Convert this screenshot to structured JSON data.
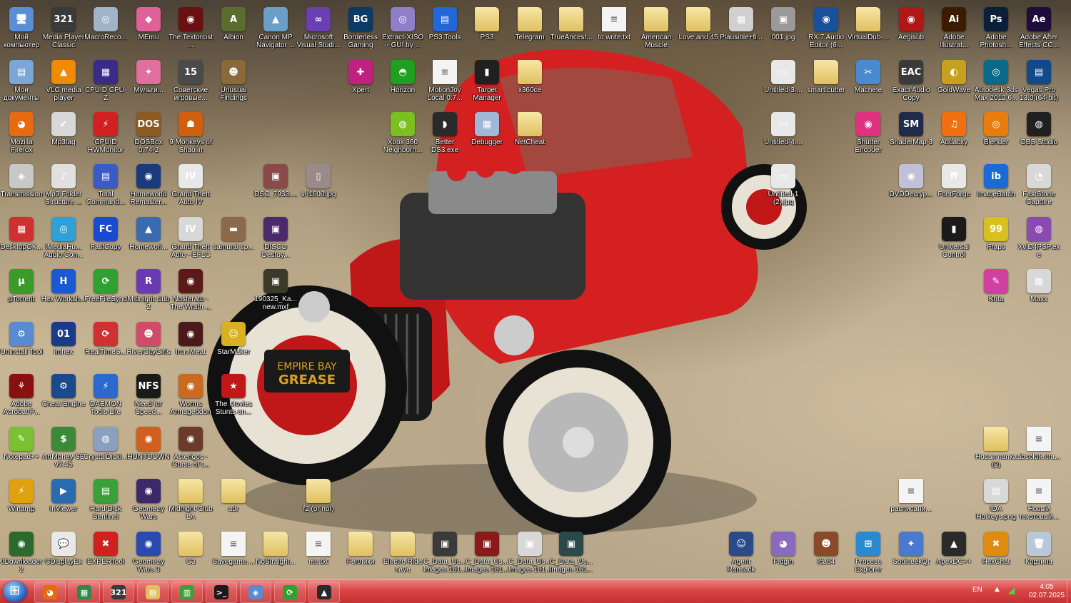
{
  "desktop": {
    "icons": [
      {
        "label": "Мой компьютер",
        "icon": "computer-icon",
        "glyph": "🖥",
        "color": "#5a8fd6"
      },
      {
        "label": "Media Player Classic",
        "icon": "mpc-icon",
        "glyph": "321",
        "color": "#3a3a3a"
      },
      {
        "label": "MacroReco...",
        "icon": "macro-icon",
        "glyph": "◎",
        "color": "#9fb4c8"
      },
      {
        "label": "MEmu",
        "icon": "memu-icon",
        "glyph": "◆",
        "color": "#e0609a"
      },
      {
        "label": "The Textorcist ...",
        "icon": "textorcist-icon",
        "glyph": "◉",
        "color": "#6a1010"
      },
      {
        "label": "Albion",
        "icon": "albion-icon",
        "glyph": "A",
        "color": "#5b6d2e"
      },
      {
        "label": "Canon MP Navigator ...",
        "icon": "canon-icon",
        "glyph": "▲",
        "color": "#6a9fc8"
      },
      {
        "label": "Microsoft Visual Studi...",
        "icon": "visual-studio-icon",
        "glyph": "∞",
        "color": "#6a3fb0"
      },
      {
        "label": "Borderless Gaming",
        "icon": "borderless-gaming-icon",
        "glyph": "BG",
        "color": "#0c3a66"
      },
      {
        "label": "Extract-XISO -- GUI by ...",
        "icon": "xiso-icon",
        "glyph": "◎",
        "color": "#8f7fc8"
      },
      {
        "label": "PS3 Tools",
        "icon": "ps3-tools-icon",
        "glyph": "▤",
        "color": "#2266d8"
      },
      {
        "label": "PS3",
        "icon": "folder-icon",
        "glyph": "",
        "color": ""
      },
      {
        "label": "Telegram",
        "icon": "folder-icon",
        "glyph": "",
        "color": ""
      },
      {
        "label": "TrueAncest...",
        "icon": "folder-icon",
        "glyph": "",
        "color": ""
      },
      {
        "label": "to write.txt",
        "icon": "text-file-icon",
        "glyph": "",
        "color": ""
      },
      {
        "label": "American Muscle",
        "icon": "folder-icon",
        "glyph": "",
        "color": ""
      },
      {
        "label": "Love and 45",
        "icon": "folder-icon",
        "glyph": "",
        "color": ""
      },
      {
        "label": "Plausible+fi...",
        "icon": "image-file-icon",
        "glyph": "▦",
        "color": "#d0d0d0"
      },
      {
        "label": "001.jpg",
        "icon": "image-file-icon",
        "glyph": "▣",
        "color": "#9a9a9a"
      },
      {
        "label": "RX 7 Audio Editor (6...",
        "icon": "rx7-icon",
        "glyph": "◉",
        "color": "#1a4f9c"
      },
      {
        "label": "VirtualDub-...",
        "icon": "folder-icon",
        "glyph": "",
        "color": ""
      },
      {
        "label": "Aegisub",
        "icon": "aegisub-icon",
        "glyph": "◉",
        "color": "#b01818"
      },
      {
        "label": "Adobe Illustrat...",
        "icon": "illustrator-icon",
        "glyph": "Ai",
        "color": "#3b1c00"
      },
      {
        "label": "Adobe Photosh...",
        "icon": "photoshop-icon",
        "glyph": "Ps",
        "color": "#0b1f3a"
      },
      {
        "label": "Adobe After Effects CC...",
        "icon": "after-effects-icon",
        "glyph": "Ae",
        "color": "#1c0d3a"
      },
      {
        "label": "Мои документы",
        "icon": "documents-icon",
        "glyph": "▤",
        "color": "#7ba7d8"
      },
      {
        "label": "VLC media player",
        "icon": "vlc-icon",
        "glyph": "▲",
        "color": "#f08a00"
      },
      {
        "label": "CPUID CPU-Z",
        "icon": "cpuz-icon",
        "glyph": "▦",
        "color": "#3a2a8a"
      },
      {
        "label": "Мульти...",
        "icon": "multi-icon",
        "glyph": "✦",
        "color": "#e070a0"
      },
      {
        "label": "Советские игровые...",
        "icon": "soviet-games-icon",
        "glyph": "15",
        "color": "#4a4a4a"
      },
      {
        "label": "Unusual Findings",
        "icon": "unusual-findings-icon",
        "glyph": "☻",
        "color": "#8a6a3a"
      },
      {
        "label": "Xpert",
        "icon": "xpert-icon",
        "glyph": "✚",
        "color": "#c02080"
      },
      {
        "label": "Horizon",
        "icon": "horizon-icon",
        "glyph": "◓",
        "color": "#20a020"
      },
      {
        "label": "MotionJoy Local 0.7...",
        "icon": "file-icon",
        "glyph": "",
        "color": ""
      },
      {
        "label": "Target Manager",
        "icon": "target-manager-icon",
        "glyph": "▮",
        "color": "#202020"
      },
      {
        "label": "x360ce",
        "icon": "folder-icon",
        "glyph": "",
        "color": ""
      },
      {
        "label": "Untitled-3....",
        "icon": "image-file-icon",
        "glyph": "▭",
        "color": "#e8e8e8"
      },
      {
        "label": "smart.cutter",
        "icon": "folder-icon",
        "glyph": "",
        "color": ""
      },
      {
        "label": "Machete",
        "icon": "machete-icon",
        "glyph": "✂",
        "color": "#4a8ad0"
      },
      {
        "label": "Exact Audio Copy",
        "icon": "eac-icon",
        "glyph": "EAC",
        "color": "#3a3a3a"
      },
      {
        "label": "GoldWave",
        "icon": "goldwave-icon",
        "glyph": "◐",
        "color": "#c8a020"
      },
      {
        "label": "Autodesk 3ds Max 2012 6...",
        "icon": "3dsmax-icon",
        "glyph": "◎",
        "color": "#0a6a8a"
      },
      {
        "label": "Vegas Pro 13.0 (64-bit)",
        "icon": "vegas-icon",
        "glyph": "▤",
        "color": "#104a8a"
      },
      {
        "label": "Mozilla Firefox",
        "icon": "firefox-icon",
        "glyph": "◕",
        "color": "#e86a10"
      },
      {
        "label": "Mp3tag",
        "icon": "mp3tag-icon",
        "glyph": "✔",
        "color": "#d8d8d8"
      },
      {
        "label": "CPUID HWMonitor",
        "icon": "hwmonitor-icon",
        "glyph": "⚡",
        "color": "#d02020"
      },
      {
        "label": "DOSBox 0.74-2",
        "icon": "dosbox-icon",
        "glyph": "DOS",
        "color": "#8a5a20"
      },
      {
        "label": "9 Monkeys of Shaolin",
        "icon": "nine-monkeys-icon",
        "glyph": "☗",
        "color": "#d06010"
      },
      {
        "label": "Xbox 360 Neighborh...",
        "icon": "xbox-icon",
        "glyph": "◍",
        "color": "#7ac020"
      },
      {
        "label": "Better DS3.exe",
        "icon": "better-ds3-icon",
        "glyph": "◗",
        "color": "#2a2a2a"
      },
      {
        "label": "Debugger",
        "icon": "debugger-icon",
        "glyph": "▦",
        "color": "#a0b8d8"
      },
      {
        "label": "NetCheat",
        "icon": "folder-icon",
        "glyph": "",
        "color": ""
      },
      {
        "label": "Untitled-4....",
        "icon": "image-file-icon",
        "glyph": "▭",
        "color": "#e8e8e8"
      },
      {
        "label": "Shutter Encoder",
        "icon": "shutter-encoder-icon",
        "glyph": "◉",
        "color": "#e03080"
      },
      {
        "label": "ShaderMap 3",
        "icon": "shadermap-icon",
        "glyph": "SM",
        "color": "#202a4a"
      },
      {
        "label": "Audacity",
        "icon": "audacity-icon",
        "glyph": "♫",
        "color": "#f07010"
      },
      {
        "label": "Blender",
        "icon": "blender-icon",
        "glyph": "◎",
        "color": "#e87d0d"
      },
      {
        "label": "OBS Studio",
        "icon": "obs-icon",
        "glyph": "◍",
        "color": "#202020"
      },
      {
        "label": "Transmission",
        "icon": "transmission-icon",
        "glyph": "◈",
        "color": "#c8c8c8"
      },
      {
        "label": "Mp3 Folder Structure ...",
        "icon": "mp3-folder-icon",
        "glyph": "♪",
        "color": "#e0e0e0"
      },
      {
        "label": "Total Command...",
        "icon": "total-commander-icon",
        "glyph": "▤",
        "color": "#3a5ac8"
      },
      {
        "label": "Homeworld Remaster...",
        "icon": "homeworld-icon",
        "glyph": "◉",
        "color": "#1a3a7a"
      },
      {
        "label": "Grand Theft Auto IV",
        "icon": "gta4-icon",
        "glyph": "IV",
        "color": "#e8e8e8"
      },
      {
        "label": "DSC_7933....",
        "icon": "image-file-icon",
        "glyph": "▣",
        "color": "#8a4a4a"
      },
      {
        "label": "s-l1600.jpg",
        "icon": "image-file-icon",
        "glyph": "▯",
        "color": "#9a8a8a"
      },
      {
        "label": "Untitled-1 (2).jpg",
        "icon": "image-file-icon",
        "glyph": "▭",
        "color": "#e8e8e8"
      },
      {
        "label": "DVDDecryp...",
        "icon": "dvd-decrypter-icon",
        "glyph": "◉",
        "color": "#c0c0d8"
      },
      {
        "label": "FontForge",
        "icon": "fontforge-icon",
        "glyph": "ff",
        "color": "#e8e8e8"
      },
      {
        "label": "ImageBatch",
        "icon": "imagebatch-icon",
        "glyph": "ib",
        "color": "#1a6ad8"
      },
      {
        "label": "FastStone Capture",
        "icon": "faststone-icon",
        "glyph": "◔",
        "color": "#d8d8d8"
      },
      {
        "label": "DesktopOK...",
        "icon": "desktopok-icon",
        "glyph": "▦",
        "color": "#d03030"
      },
      {
        "label": "iMediaHu... Audio Con...",
        "icon": "imediahub-icon",
        "glyph": "◎",
        "color": "#30a0d8"
      },
      {
        "label": "FastCopy",
        "icon": "fastcopy-icon",
        "glyph": "FC",
        "color": "#1a4ad0"
      },
      {
        "label": "Homeworl...",
        "icon": "homeworld2-icon",
        "glyph": "▲",
        "color": "#3a6ab0"
      },
      {
        "label": "Grand Theft Auto - EFLC",
        "icon": "gta-eflc-icon",
        "glyph": "IV",
        "color": "#d8d8d8"
      },
      {
        "label": "samurai sp...",
        "icon": "image-file-icon",
        "glyph": "▬",
        "color": "#8a6a4a"
      },
      {
        "label": "DISCO Destoy...",
        "icon": "image-file-icon",
        "glyph": "▣",
        "color": "#4a2a6a"
      },
      {
        "label": "Universal Control",
        "icon": "universal-control-icon",
        "glyph": "▮",
        "color": "#1a1a1a"
      },
      {
        "label": "Fraps",
        "icon": "fraps-icon",
        "glyph": "99",
        "color": "#d8c020"
      },
      {
        "label": "XviD4PSP.exe",
        "icon": "xvid4psp-icon",
        "glyph": "◍",
        "color": "#8a4ab0"
      },
      {
        "label": "µTorrent",
        "icon": "utorrent-icon",
        "glyph": "µ",
        "color": "#3a9a2a"
      },
      {
        "label": "Hex Worksh...",
        "icon": "hex-workshop-icon",
        "glyph": "H",
        "color": "#1a5ad0"
      },
      {
        "label": "FreeFileSync",
        "icon": "freefilesync-icon",
        "glyph": "⟳",
        "color": "#30a030"
      },
      {
        "label": "Midnight club 2",
        "icon": "midnight-club-icon",
        "glyph": "R",
        "color": "#6a3ab0"
      },
      {
        "label": "Nosferatu - The Wrath ...",
        "icon": "nosferatu-icon",
        "glyph": "◉",
        "color": "#5a1a1a"
      },
      {
        "label": "190325_Ka... new.mxf",
        "icon": "video-file-icon",
        "glyph": "▣",
        "color": "#3a3a2a"
      },
      {
        "label": "Krita",
        "icon": "krita-icon",
        "glyph": "✎",
        "color": "#d040a0"
      },
      {
        "label": "Maxx",
        "icon": "maxx-icon",
        "glyph": "▦",
        "color": "#d8d8d8"
      },
      {
        "label": "Uninstall Tool",
        "icon": "uninstall-tool-icon",
        "glyph": "⚙",
        "color": "#5a8ad0"
      },
      {
        "label": "imhex",
        "icon": "imhex-icon",
        "glyph": "01",
        "color": "#1a3a8a"
      },
      {
        "label": "RealTimeS...",
        "icon": "realtime-sync-icon",
        "glyph": "⟳",
        "color": "#d03030"
      },
      {
        "label": "RiverCityGirls",
        "icon": "river-city-girls-icon",
        "glyph": "☻",
        "color": "#d04a6a"
      },
      {
        "label": "Iron Meat",
        "icon": "iron-meat-icon",
        "glyph": "◉",
        "color": "#4a1a1a"
      },
      {
        "label": "StarMaker",
        "icon": "starmaker-icon",
        "glyph": "☺",
        "color": "#d8b020"
      },
      {
        "label": "Adobe Acrobat P...",
        "icon": "acrobat-icon",
        "glyph": "⚘",
        "color": "#8a1010"
      },
      {
        "label": "Cheat Engine",
        "icon": "cheat-engine-icon",
        "glyph": "⚙",
        "color": "#1a4a8a"
      },
      {
        "label": "DAEMON Tools Lite",
        "icon": "daemon-tools-icon",
        "glyph": "⚡",
        "color": "#2a6ad0"
      },
      {
        "label": "Need for Speed...",
        "icon": "nfs-icon",
        "glyph": "NFS",
        "color": "#1a1a1a"
      },
      {
        "label": "Worms Armageddon",
        "icon": "worms-icon",
        "glyph": "◉",
        "color": "#c86a20"
      },
      {
        "label": "The Movies Stunts an...",
        "icon": "the-movies-icon",
        "glyph": "★",
        "color": "#c01818"
      },
      {
        "label": "Notepad++",
        "icon": "notepadpp-icon",
        "glyph": "✎",
        "color": "#7ac030"
      },
      {
        "label": "ArtMoney SE v7.45",
        "icon": "artmoney-icon",
        "glyph": "$",
        "color": "#3a8a3a"
      },
      {
        "label": "CrystalDiskI...",
        "icon": "crystaldisk-icon",
        "glyph": "◍",
        "color": "#8aa0c0"
      },
      {
        "label": "HUNTDOWN",
        "icon": "huntdown-icon",
        "glyph": "◉",
        "color": "#d06020"
      },
      {
        "label": "Asterigos - Curse of t...",
        "icon": "asterigos-icon",
        "glyph": "◉",
        "color": "#6a3a2a"
      },
      {
        "label": "Новая папка (2)",
        "icon": "folder-icon",
        "glyph": "",
        "color": ""
      },
      {
        "label": "absolute.tra...",
        "icon": "text-file-icon",
        "glyph": "",
        "color": ""
      },
      {
        "label": "Winamp",
        "icon": "winamp-icon",
        "glyph": "⚡",
        "color": "#e0a010"
      },
      {
        "label": "InViewer",
        "icon": "inviewer-icon",
        "glyph": "▶",
        "color": "#2a6ab0"
      },
      {
        "label": "Hard Disk Sentinel",
        "icon": "hdsentinel-icon",
        "glyph": "▤",
        "color": "#3aa03a"
      },
      {
        "label": "Geometry Wars",
        "icon": "geometry-wars-icon",
        "glyph": "◉",
        "color": "#3a2a6a"
      },
      {
        "label": "Midnight Club LA",
        "icon": "folder-icon",
        "glyph": "",
        "color": ""
      },
      {
        "label": "adr",
        "icon": "folder-icon",
        "glyph": "",
        "color": ""
      },
      {
        "label": "f2 (or not)",
        "icon": "folder-icon",
        "glyph": "",
        "color": ""
      },
      {
        "label": "расписани...",
        "icon": "text-file-icon",
        "glyph": "",
        "color": ""
      },
      {
        "label": "IDA Hotkeys.png",
        "icon": "image-file-icon",
        "glyph": "▤",
        "color": "#d8d8d8"
      },
      {
        "label": "Новый текстовый...",
        "icon": "text-file-icon",
        "glyph": "",
        "color": ""
      },
      {
        "label": "JDownloader 2",
        "icon": "jdownloader-icon",
        "glyph": "◉",
        "color": "#2a6a2a"
      },
      {
        "label": "CDisplayEx",
        "icon": "cdisplayex-icon",
        "glyph": "💬",
        "color": "#e8e8e8"
      },
      {
        "label": "EXPERTool",
        "icon": "expertool-icon",
        "glyph": "✖",
        "color": "#d02020"
      },
      {
        "label": "Geometry Wars 3",
        "icon": "geometry-wars-3-icon",
        "glyph": "◉",
        "color": "#2a4ab0"
      },
      {
        "label": "C3",
        "icon": "folder-icon",
        "glyph": "",
        "color": ""
      },
      {
        "label": "Savegame....",
        "icon": "text-file-icon",
        "glyph": "",
        "color": ""
      },
      {
        "label": "NoStraight...",
        "icon": "folder-icon",
        "glyph": "",
        "color": ""
      },
      {
        "label": "ms.txt",
        "icon": "text-file-icon",
        "glyph": "",
        "color": ""
      },
      {
        "label": "Реплики",
        "icon": "folder-icon",
        "glyph": "",
        "color": ""
      },
      {
        "label": "Electro Ride save",
        "icon": "folder-icon",
        "glyph": "",
        "color": ""
      },
      {
        "label": "C_Data_Us... Images 161...",
        "icon": "image-file-icon",
        "glyph": "▣",
        "color": "#3a3a3a"
      },
      {
        "label": "C_Data_Us... Images 161...",
        "icon": "image-file-icon",
        "glyph": "▣",
        "color": "#8a1a1a"
      },
      {
        "label": "C_Data_Us... Images 161...",
        "icon": "image-file-icon",
        "glyph": "▣",
        "color": "#d8d8d8"
      },
      {
        "label": "C_Data_Us... Images 161...",
        "icon": "image-file-icon",
        "glyph": "▣",
        "color": "#2a4a4a"
      },
      {
        "label": "Agent Ransack",
        "icon": "agent-ransack-icon",
        "glyph": "☺",
        "color": "#2a4a8a"
      },
      {
        "label": "Pidgin",
        "icon": "pidgin-icon",
        "glyph": "◕",
        "color": "#8a6ac0"
      },
      {
        "label": "ida64",
        "icon": "ida64-icon",
        "glyph": "☻",
        "color": "#8a4a2a"
      },
      {
        "label": "Process Explorer",
        "icon": "process-explorer-icon",
        "glyph": "⊞",
        "color": "#2a8ad0"
      },
      {
        "label": "SoulseekQt",
        "icon": "soulseek-icon",
        "glyph": "✦",
        "color": "#4a7ad0"
      },
      {
        "label": "ApexDC++",
        "icon": "apexdc-icon",
        "glyph": "▲",
        "color": "#2a2a2a"
      },
      {
        "label": "HexChat",
        "icon": "hexchat-icon",
        "glyph": "✖",
        "color": "#e08a10"
      },
      {
        "label": "Корзина",
        "icon": "recycle-bin-icon",
        "glyph": "🗑",
        "color": "#b8c8d8"
      }
    ]
  },
  "taskbar": {
    "items": [
      {
        "icon": "firefox-icon",
        "glyph": "◕",
        "color": "#e86a10"
      },
      {
        "icon": "monitor-app-icon",
        "glyph": "▦",
        "color": "#2a8a4a"
      },
      {
        "icon": "mpc-icon",
        "glyph": "321",
        "color": "#3a3a3a"
      },
      {
        "icon": "explorer-icon",
        "glyph": "▤",
        "color": "#e0c060"
      },
      {
        "icon": "chart-app-icon",
        "glyph": "▥",
        "color": "#3aa03a"
      },
      {
        "icon": "console-icon",
        "glyph": ">_",
        "color": "#1a1a1a"
      },
      {
        "icon": "network-app-icon",
        "glyph": "◈",
        "color": "#5a8ad0"
      },
      {
        "icon": "freefilesync-icon",
        "glyph": "⟳",
        "color": "#30a030"
      },
      {
        "icon": "apexdc-icon",
        "glyph": "▲",
        "color": "#2a2a2a"
      }
    ],
    "language": "EN",
    "time": "4:05",
    "date": "02.07.2025"
  }
}
